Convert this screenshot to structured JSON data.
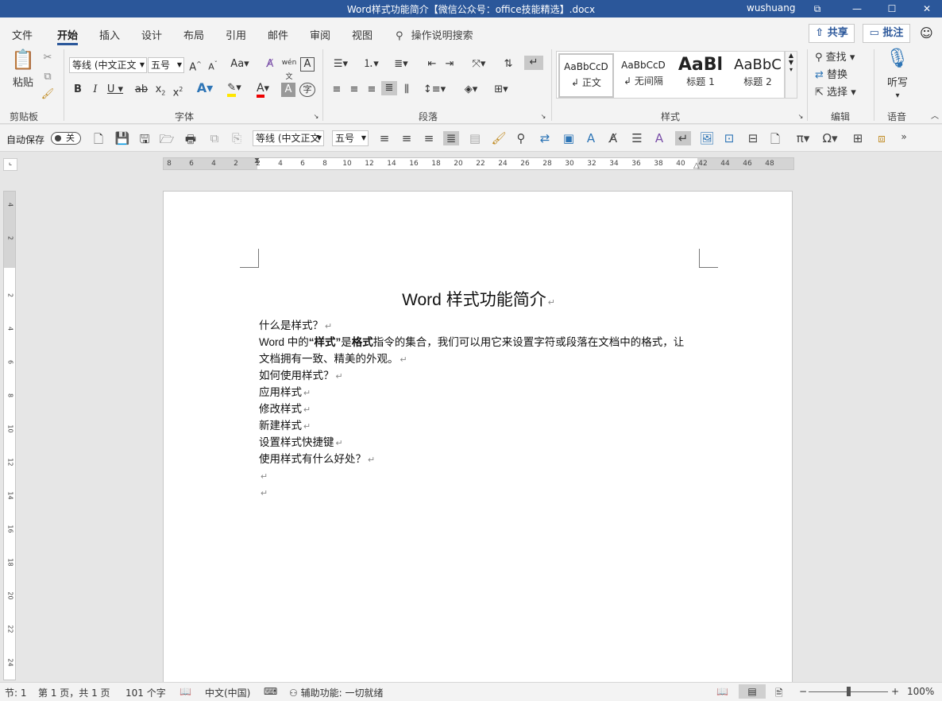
{
  "window": {
    "title": "Word样式功能简介【微信公众号：office技能精选】.docx",
    "user": "wushuang",
    "controls": [
      "⧉",
      "—",
      "☐",
      "✕"
    ]
  },
  "menu": {
    "tabs": [
      "文件",
      "开始",
      "插入",
      "设计",
      "布局",
      "引用",
      "邮件",
      "审阅",
      "视图"
    ],
    "active": "开始",
    "tell_me": "操作说明搜索",
    "share": "共享",
    "comments": "批注"
  },
  "ribbon": {
    "clipboard": {
      "label": "剪贴板",
      "paste": "粘贴"
    },
    "font": {
      "label": "字体",
      "font_name": "等线 (中文正文",
      "font_size": "五号"
    },
    "paragraph": {
      "label": "段落"
    },
    "styles": {
      "label": "样式",
      "items": [
        {
          "sample": "AaBbCcD",
          "name": "正文"
        },
        {
          "sample": "AaBbCcD",
          "name": "无间隔"
        },
        {
          "sample": "AaBl",
          "name": "标题 1"
        },
        {
          "sample": "AaBbC",
          "name": "标题 2"
        }
      ]
    },
    "editing": {
      "label": "编辑",
      "find": "查找",
      "replace": "替换",
      "select": "选择"
    },
    "voice": {
      "label": "语音",
      "dictate": "听写"
    }
  },
  "qat": {
    "autosave_label": "自动保存",
    "autosave_state": "关",
    "font_name": "等线 (中文正文",
    "font_size": "五号"
  },
  "ruler": {
    "h_ticks": [
      "8",
      "6",
      "4",
      "2",
      "2",
      "4",
      "6",
      "8",
      "10",
      "12",
      "14",
      "16",
      "18",
      "20",
      "22",
      "24",
      "26",
      "28",
      "30",
      "32",
      "34",
      "36",
      "38",
      "40",
      "42",
      "44",
      "46",
      "48"
    ],
    "v_ticks": [
      "4",
      "2",
      "2",
      "4",
      "6",
      "8",
      "10",
      "12",
      "14",
      "16",
      "18",
      "20",
      "22",
      "24"
    ]
  },
  "document": {
    "title": "Word 样式功能简介",
    "paragraphs": [
      "什么是样式？",
      "Word 中的",
      "样式",
      "是",
      "格式",
      "指令的集合，我们可以用它来设置字符或段落在文档中的格式，让",
      "文档拥有一致、精美的外观。",
      "如何使用样式？",
      "应用样式",
      "修改样式",
      "新建样式",
      "设置样式快捷键",
      "使用样式有什么好处？"
    ]
  },
  "status": {
    "section": "节: 1",
    "page": "第 1 页，共 1 页",
    "words": "101 个字",
    "language": "中文(中国)",
    "accessibility": "辅助功能: 一切就绪",
    "zoom": "100%"
  }
}
